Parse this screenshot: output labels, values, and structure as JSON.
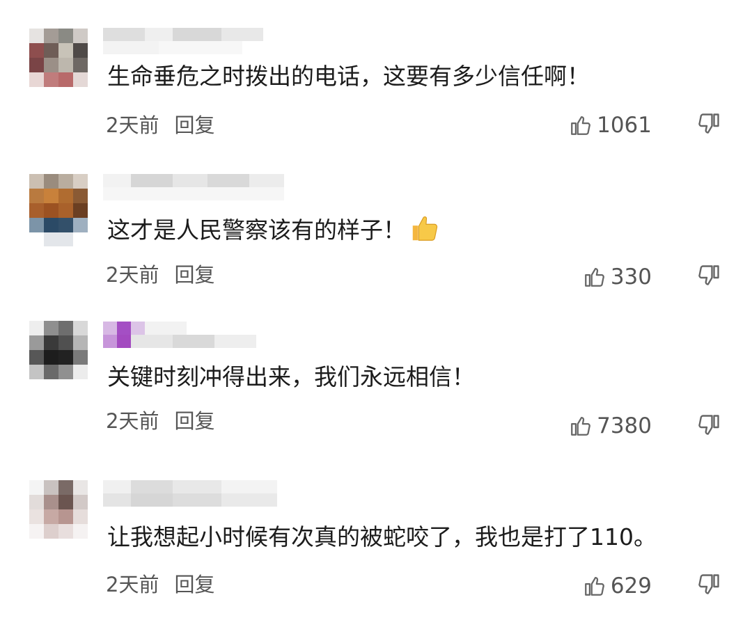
{
  "colors": {
    "text": "#1c1c1c",
    "meta": "#555555",
    "icon": "#666666"
  },
  "comments": [
    {
      "text": "生命垂危之时拨出的电话，这要有多少信任啊！",
      "time": "2天前",
      "reply": "回复",
      "likes": "1061",
      "emoji": ""
    },
    {
      "text": "这才是人民警察该有的样子！",
      "time": "2天前",
      "reply": "回复",
      "likes": "330",
      "emoji": "thumbs-up"
    },
    {
      "text": "关键时刻冲得出来，我们永远相信！",
      "time": "2天前",
      "reply": "回复",
      "likes": "7380",
      "emoji": ""
    },
    {
      "text": "让我想起小时候有次真的被蛇咬了，我也是打了110。",
      "time": "2天前",
      "reply": "回复",
      "likes": "629",
      "emoji": ""
    }
  ]
}
